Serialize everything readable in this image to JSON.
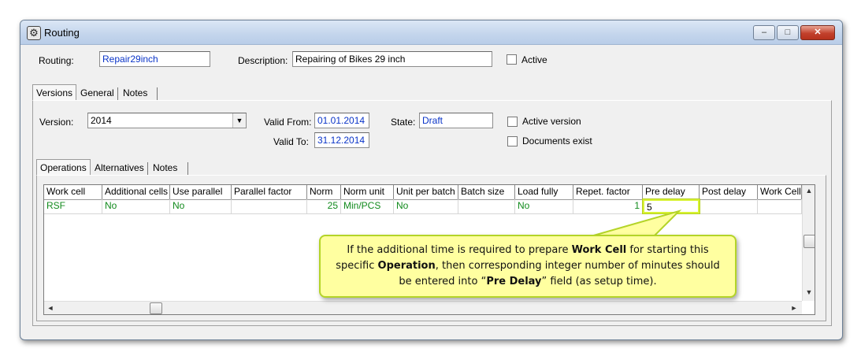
{
  "window": {
    "title": "Routing",
    "buttons": {
      "minimize": "–",
      "maximize": "□",
      "close": "✕"
    }
  },
  "routing": {
    "routing_label": "Routing:",
    "routing_value": "Repair29inch",
    "description_label": "Description:",
    "description_value": "Repairing of Bikes 29 inch",
    "active_label": "Active"
  },
  "outer_tabs": [
    "Versions",
    "General",
    "Notes"
  ],
  "version": {
    "version_label": "Version:",
    "version_value": "2014",
    "valid_from_label": "Valid From:",
    "valid_from_value": "01.01.2014",
    "valid_to_label": "Valid To:",
    "valid_to_value": "31.12.2014",
    "state_label": "State:",
    "state_value": "Draft",
    "active_version_label": "Active version",
    "documents_exist_label": "Documents exist"
  },
  "inner_tabs": [
    "Operations",
    "Alternatives",
    "Notes"
  ],
  "grid": {
    "columns": [
      "Work cell",
      "Additional cells",
      "Use parallel",
      "Parallel factor",
      "Norm",
      "Norm unit",
      "Unit per batch",
      "Batch size",
      "Load fully",
      "Repet. factor",
      "Pre delay",
      "Post delay",
      "Work Cell"
    ],
    "rows": [
      [
        "RSF",
        "No",
        "No",
        "",
        "25",
        "Min/PCS",
        "No",
        "",
        "No",
        "1",
        "5",
        "",
        ""
      ]
    ]
  },
  "callout": {
    "p1": "If the additional time is required to prepare ",
    "b1": "Work Cell",
    "p2": " for starting this specific ",
    "b2": "Operation",
    "p3": ", then corresponding integer number of minutes should be entered into “",
    "b3": "Pre Delay",
    "p4": "” field (as setup time)."
  },
  "icons": {
    "app": "gear-icon",
    "dropdown": "chevron-down-icon",
    "scroll_up": "arrow-up-icon",
    "scroll_down": "arrow-down-icon",
    "scroll_left": "arrow-left-icon",
    "scroll_right": "arrow-right-icon"
  },
  "colors": {
    "value_text": "#0a34c8",
    "grid_text": "#118a1c",
    "highlight": "#d8f233",
    "callout_bg": "#ffffa0"
  }
}
